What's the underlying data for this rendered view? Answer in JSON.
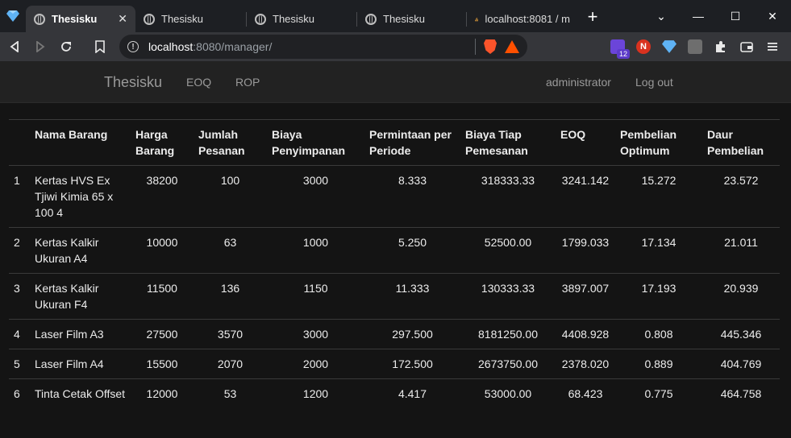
{
  "browser": {
    "tabs": [
      {
        "title": "Thesisku",
        "active": true
      },
      {
        "title": "Thesisku",
        "active": false
      },
      {
        "title": "Thesisku",
        "active": false
      },
      {
        "title": "Thesisku",
        "active": false
      },
      {
        "title": "localhost:8081 / m",
        "active": false
      }
    ],
    "url_host": "localhost",
    "url_rest": ":8080/manager/",
    "extension_badge": "12",
    "accent_color": "#fb542b"
  },
  "nav": {
    "brand": "Thesisku",
    "links": [
      "EOQ",
      "ROP"
    ],
    "user": "administrator",
    "logout": "Log out"
  },
  "table": {
    "headers": [
      "",
      "Nama Barang",
      "Harga Barang",
      "Jumlah Pesanan",
      "Biaya Penyimpanan",
      "Permintaan per Periode",
      "Biaya Tiap Pemesanan",
      "EOQ",
      "Pembelian Optimum",
      "Daur Pembelian"
    ],
    "rows": [
      [
        "1",
        "Kertas HVS Ex Tjiwi Kimia 65 x 100 4",
        "38200",
        "100",
        "3000",
        "8.333",
        "318333.33",
        "3241.142",
        "15.272",
        "23.572"
      ],
      [
        "2",
        "Kertas Kalkir Ukuran A4",
        "10000",
        "63",
        "1000",
        "5.250",
        "52500.00",
        "1799.033",
        "17.134",
        "21.011"
      ],
      [
        "3",
        "Kertas Kalkir Ukuran F4",
        "11500",
        "136",
        "1150",
        "11.333",
        "130333.33",
        "3897.007",
        "17.193",
        "20.939"
      ],
      [
        "4",
        "Laser Film A3",
        "27500",
        "3570",
        "3000",
        "297.500",
        "8181250.00",
        "4408.928",
        "0.808",
        "445.346"
      ],
      [
        "5",
        "Laser Film A4",
        "15500",
        "2070",
        "2000",
        "172.500",
        "2673750.00",
        "2378.020",
        "0.889",
        "404.769"
      ],
      [
        "6",
        "Tinta Cetak Offset",
        "12000",
        "53",
        "1200",
        "4.417",
        "53000.00",
        "68.423",
        "0.775",
        "464.758"
      ]
    ]
  }
}
